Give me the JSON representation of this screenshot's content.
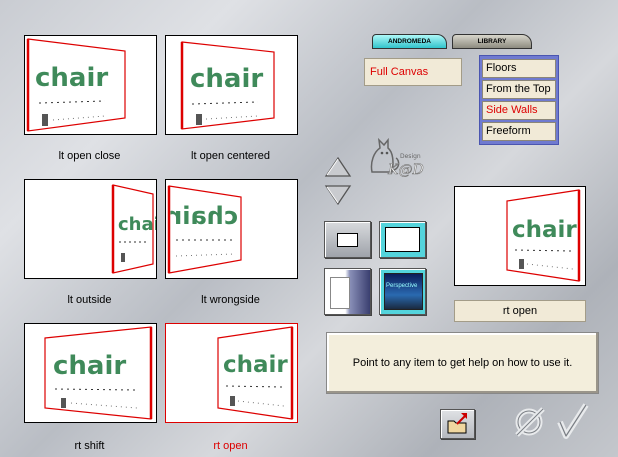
{
  "tabs": {
    "active": "ANDROMEDA",
    "inactive": "LIBRARY"
  },
  "presets": {
    "items": [
      {
        "label": "lt open close",
        "state": "default"
      },
      {
        "label": "lt open centered",
        "state": "default"
      },
      {
        "label": "lt outside",
        "state": "default"
      },
      {
        "label": "lt wrongside",
        "state": "default"
      },
      {
        "label": "rt shift",
        "state": "default"
      },
      {
        "label": "rt open",
        "state": "selected"
      }
    ],
    "thumb_word": "chair",
    "thumb_word_mirrored": "chair"
  },
  "canvas_field": {
    "value": "Full Canvas"
  },
  "mode_list": {
    "items": [
      {
        "label": "Floors",
        "state": "default"
      },
      {
        "label": "From the Top",
        "state": "default"
      },
      {
        "label": "Side Walls",
        "state": "selected"
      },
      {
        "label": "Freeform",
        "state": "default"
      }
    ]
  },
  "logo": {
    "text": "K@D",
    "subtext": "Design"
  },
  "tools": {
    "perspective_label": "Perspective"
  },
  "preview": {
    "label": "rt open",
    "word": "chair"
  },
  "help": {
    "text": "Point to any item to get help on how to use it."
  },
  "colors": {
    "accent_red": "#dd0000",
    "list_border": "#5c67c8",
    "tab_active": "#3cc8d0",
    "cream": "#f1ead7",
    "word_green": "#3f8a5a"
  },
  "icons": [
    "arrow-up-icon",
    "arrow-down-icon",
    "folder-icon",
    "cancel-icon",
    "check-icon"
  ]
}
